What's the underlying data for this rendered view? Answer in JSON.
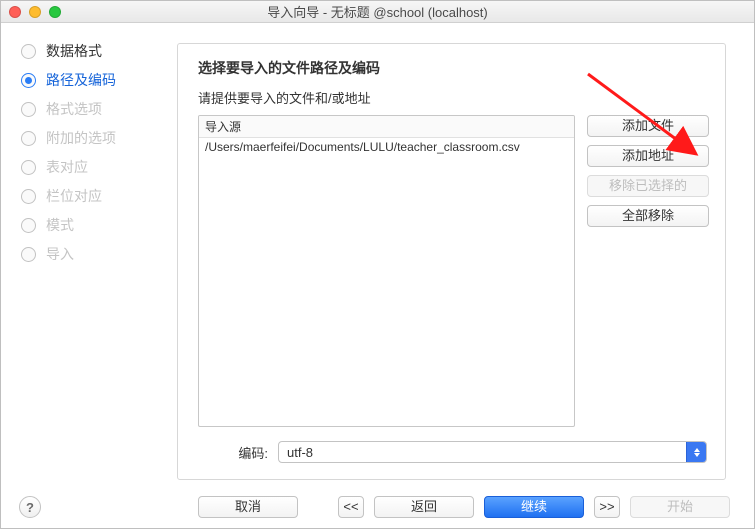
{
  "window": {
    "title": "导入向导 - 无标题 @school (localhost)"
  },
  "sidebar": {
    "items": [
      {
        "label": "数据格式",
        "state": "done"
      },
      {
        "label": "路径及编码",
        "state": "active"
      },
      {
        "label": "格式选项",
        "state": "disabled"
      },
      {
        "label": "附加的选项",
        "state": "disabled"
      },
      {
        "label": "表对应",
        "state": "disabled"
      },
      {
        "label": "栏位对应",
        "state": "disabled"
      },
      {
        "label": "模式",
        "state": "disabled"
      },
      {
        "label": "导入",
        "state": "disabled"
      }
    ]
  },
  "content": {
    "heading": "选择要导入的文件路径及编码",
    "subheading": "请提供要导入的文件和/或地址",
    "list_header": "导入源",
    "rows": [
      "/Users/maerfeifei/Documents/LULU/teacher_classroom.csv"
    ],
    "side_buttons": {
      "add_file": "添加文件",
      "add_url": "添加地址",
      "remove_selected": "移除已选择的",
      "remove_all": "全部移除"
    },
    "encoding": {
      "label": "编码:",
      "value": "utf-8"
    }
  },
  "footer": {
    "help": "?",
    "cancel": "取消",
    "prev_nav": "<<",
    "back": "返回",
    "continue": "继续",
    "next_nav": ">>",
    "start": "开始"
  },
  "annotation": {
    "arrow_color": "#ff1a1a"
  }
}
